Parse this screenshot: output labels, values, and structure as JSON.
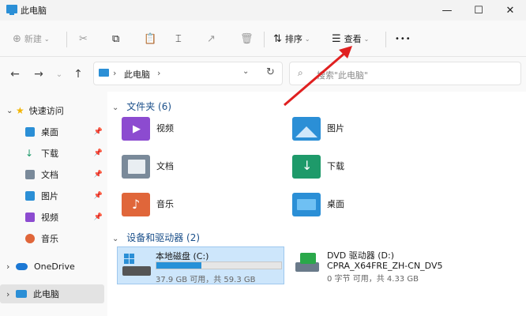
{
  "window": {
    "title": "此电脑",
    "controls": [
      "—",
      "☐",
      "✕"
    ]
  },
  "toolbar": {
    "new_label": "新建",
    "sort_label": "排序",
    "view_label": "查看",
    "more_label": "•••"
  },
  "address": {
    "path": "此电脑",
    "search_placeholder": "搜索\"此电脑\""
  },
  "sidebar": {
    "items": [
      {
        "label": "快速访问",
        "icon": "star-icon",
        "color": "#f2b400"
      },
      {
        "label": "桌面",
        "icon": "desktop-icon",
        "color": "#2b8fd6",
        "pinned": true
      },
      {
        "label": "下载",
        "icon": "download-icon",
        "color": "#1e9a6a",
        "pinned": true
      },
      {
        "label": "文档",
        "icon": "document-icon",
        "color": "#7a8a9a",
        "pinned": true
      },
      {
        "label": "图片",
        "icon": "picture-icon",
        "color": "#2b8fd6",
        "pinned": true
      },
      {
        "label": "视频",
        "icon": "video-icon",
        "color": "#8c4bd0",
        "pinned": true
      },
      {
        "label": "音乐",
        "icon": "music-icon",
        "color": "#e0663a",
        "pinned": true
      },
      {
        "label": "OneDrive",
        "icon": "cloud-icon",
        "color": "#1c78d4"
      },
      {
        "label": "此电脑",
        "icon": "computer-icon",
        "color": "#2b8fd6"
      }
    ]
  },
  "main": {
    "folders_header": "文件夹 (6)",
    "folders": [
      {
        "label": "视频",
        "icon": "video-folder-icon",
        "color": "#8c4bd0"
      },
      {
        "label": "图片",
        "icon": "picture-folder-icon",
        "color": "#2b8fd6"
      },
      {
        "label": "文档",
        "icon": "document-folder-icon",
        "color": "#7a8a9a"
      },
      {
        "label": "下载",
        "icon": "download-folder-icon",
        "color": "#1e9a6a"
      },
      {
        "label": "音乐",
        "icon": "music-folder-icon",
        "color": "#e0663a"
      },
      {
        "label": "桌面",
        "icon": "desktop-folder-icon",
        "color": "#2b8fd6"
      }
    ],
    "devices_header": "设备和驱动器 (2)",
    "drives": [
      {
        "name": "本地磁盘 (C:)",
        "info": "37.9 GB 可用，共 59.3 GB",
        "used_fraction": 0.36
      },
      {
        "name": "DVD 驱动器 (D:)",
        "subname": "CPRA_X64FRE_ZH-CN_DV5",
        "info": "0 字节 可用，共 4.33 GB"
      }
    ]
  },
  "colors": {
    "accent": "#2b8fd6",
    "annotation_arrow": "#e02020"
  }
}
